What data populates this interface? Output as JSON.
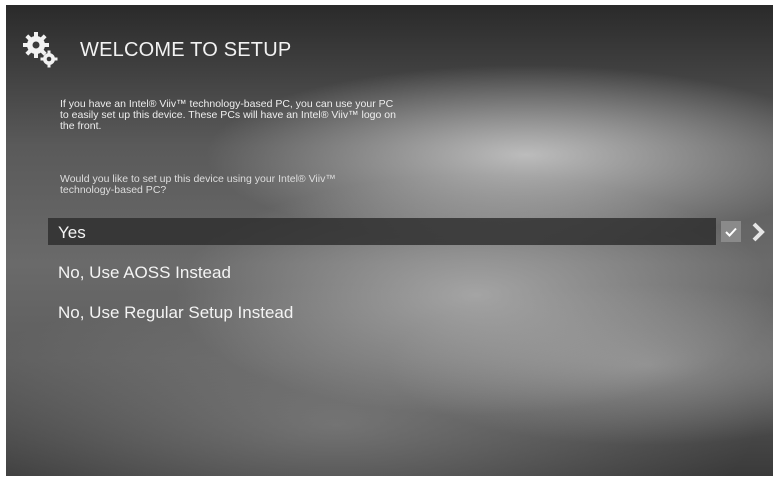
{
  "header": {
    "title": "WELCOME TO SETUP",
    "icon": "gear-icon"
  },
  "body": {
    "description": "If you have an Intel® Viiv™ technology-based PC, you can use your PC to easily set up this device. These PCs will have an Intel® Viiv™ logo on the front.",
    "question": "Would you like to set up this device using your Intel® Viiv™ technology-based PC?"
  },
  "options": {
    "yes": "Yes",
    "aoss": "No, Use AOSS Instead",
    "regular": "No, Use Regular Setup Instead"
  },
  "controls": {
    "check_icon": "checkmark-icon",
    "next_icon": "chevron-right-icon"
  },
  "colors": {
    "text": "#f4f4f4",
    "selection": "#2d2d2d"
  }
}
